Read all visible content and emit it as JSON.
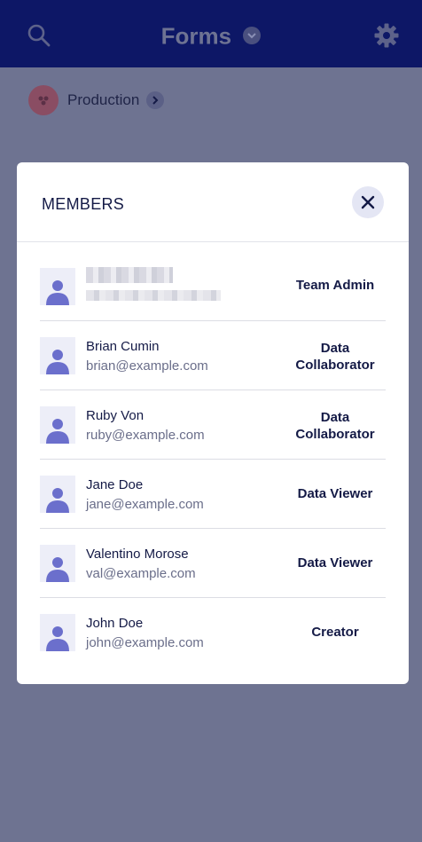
{
  "header": {
    "title": "Forms"
  },
  "breadcrumb": {
    "label": "Production"
  },
  "modal": {
    "title": "MEMBERS",
    "members": [
      {
        "name": "",
        "email": "",
        "role": "Team Admin",
        "redacted": true
      },
      {
        "name": "Brian Cumin",
        "email": "brian@example.com",
        "role_lines": [
          "Data",
          "Collaborator"
        ]
      },
      {
        "name": "Ruby Von",
        "email": "ruby@example.com",
        "role_lines": [
          "Data",
          "Collaborator"
        ]
      },
      {
        "name": "Jane Doe",
        "email": "jane@example.com",
        "role": "Data Viewer"
      },
      {
        "name": "Valentino Morose",
        "email": "val@example.com",
        "role": "Data Viewer"
      },
      {
        "name": "John Doe",
        "email": "john@example.com",
        "role": "Creator"
      }
    ]
  },
  "colors": {
    "topbar": "#0d1766",
    "overlay": "#6e7391",
    "avatar_icon": "#6b6fcc",
    "text_dark": "#141a46"
  }
}
